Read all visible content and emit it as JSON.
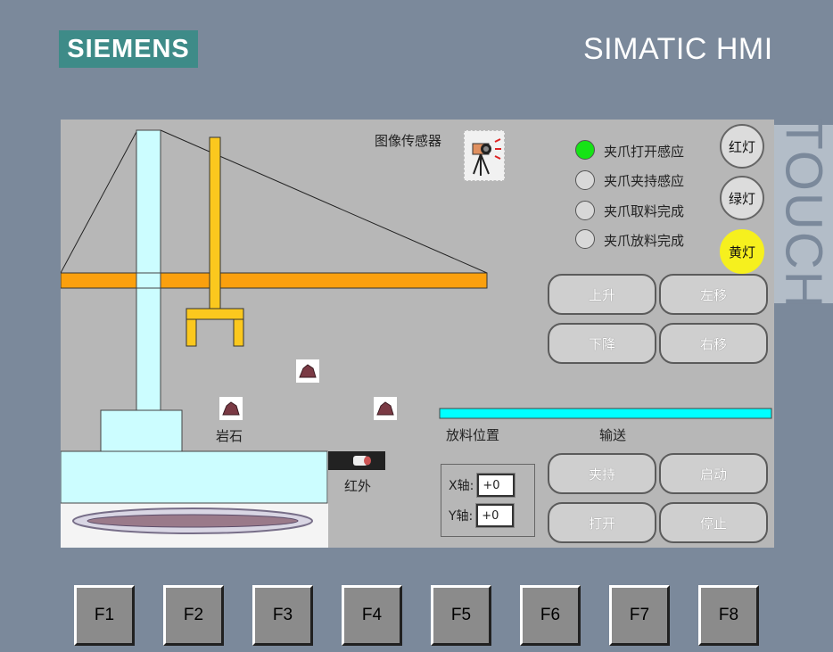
{
  "brand": {
    "logo": "SIEMENS",
    "product": "SIMATIC HMI",
    "panel_tag": "TOUCH"
  },
  "scene": {
    "sensor_label": "图像传感器",
    "rock_label": "岩石",
    "ir_label": "红外",
    "drop_label": "放料位置",
    "conveyor_label": "输送"
  },
  "indicators": [
    {
      "label": "夹爪打开感应",
      "state": "on"
    },
    {
      "label": "夹爪夹持感应",
      "state": "off"
    },
    {
      "label": "夹爪取料完成",
      "state": "off"
    },
    {
      "label": "夹爪放料完成",
      "state": "off"
    }
  ],
  "lamps": {
    "red": "红灯",
    "green": "绿灯",
    "yellow": "黄灯"
  },
  "motion_buttons": {
    "up": "上升",
    "left": "左移",
    "down": "下降",
    "right": "右移"
  },
  "control_buttons": {
    "clamp": "夹持",
    "start": "启动",
    "open": "打开",
    "stop": "停止"
  },
  "axes": {
    "x_label": "X轴:",
    "x_value": "+0",
    "y_label": "Y轴:",
    "y_value": "+0"
  },
  "function_keys": [
    "F1",
    "F2",
    "F3",
    "F4",
    "F5",
    "F6",
    "F7",
    "F8"
  ],
  "colors": {
    "crane_arm": "#fba00e",
    "gripper": "#fbc81e",
    "tower": "#ccfdff",
    "conveyor": "#00ffff",
    "led_on": "#16e316",
    "lamp_yellow": "#f6f01e",
    "logo_bg": "#3e8b88"
  }
}
